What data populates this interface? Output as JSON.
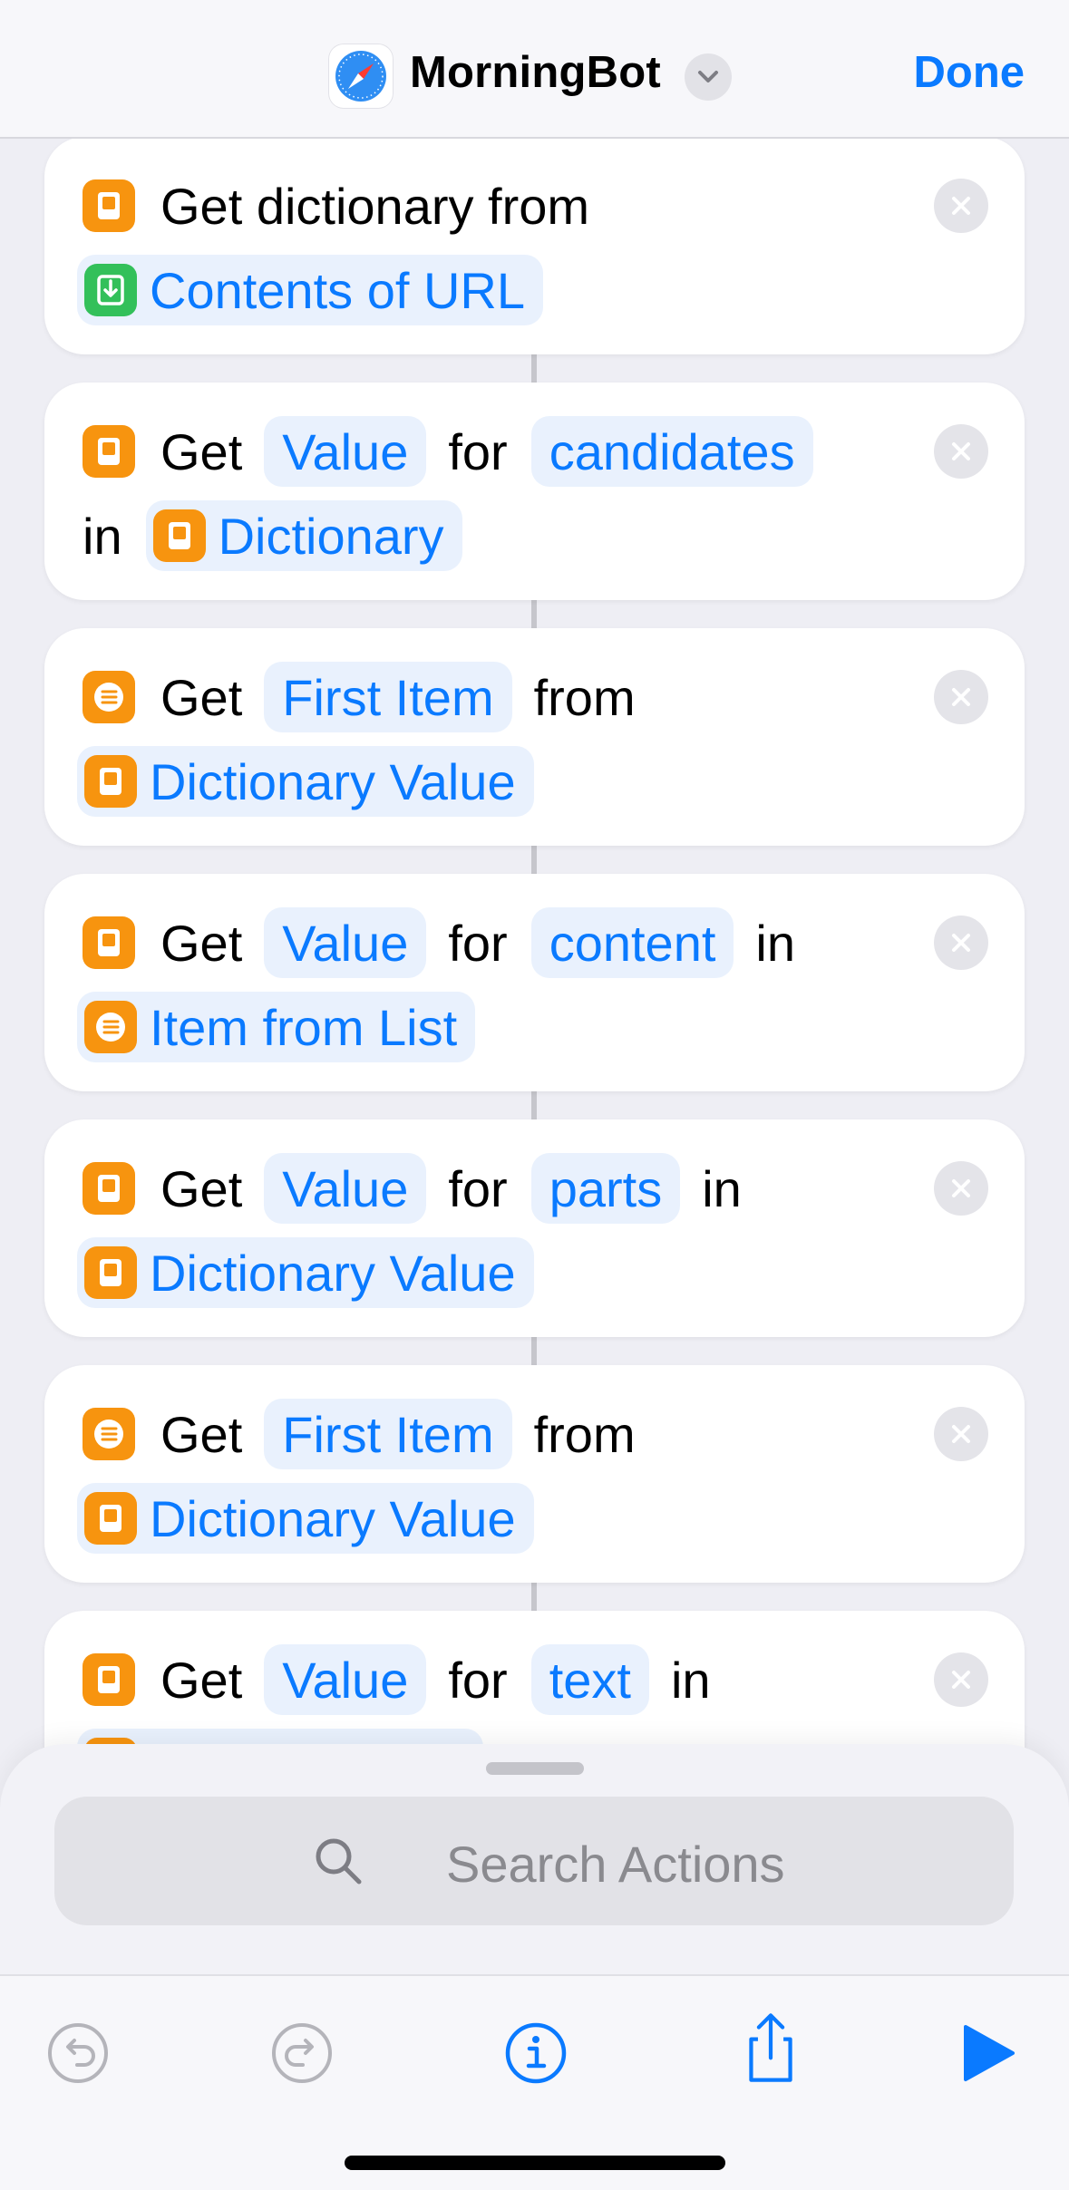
{
  "header": {
    "app_icon": "safari-compass-icon",
    "title": "MorningBot",
    "chevron": "chevron-down-icon",
    "done_label": "Done"
  },
  "actions": [
    {
      "icon": "dictionary-icon",
      "line1": {
        "lead": "Get dictionary from"
      },
      "line2": {
        "var_icon": "download-icon",
        "var_label": "Contents of URL"
      }
    },
    {
      "icon": "dictionary-icon",
      "line1": {
        "lead": "Get",
        "param1": "Value",
        "mid": "for",
        "param2": "candidates"
      },
      "line2": {
        "lead": "in",
        "var_icon": "dictionary-icon",
        "var_label": "Dictionary"
      }
    },
    {
      "icon": "list-icon",
      "line1": {
        "lead": "Get",
        "param1": "First Item",
        "mid": "from"
      },
      "line2": {
        "var_icon": "dictionary-icon",
        "var_label": "Dictionary Value"
      }
    },
    {
      "icon": "dictionary-icon",
      "line1": {
        "lead": "Get",
        "param1": "Value",
        "mid": "for",
        "param2": "content",
        "tail": "in"
      },
      "line2": {
        "var_icon": "list-icon",
        "var_label": "Item from List"
      }
    },
    {
      "icon": "dictionary-icon",
      "line1": {
        "lead": "Get",
        "param1": "Value",
        "mid": "for",
        "param2": "parts",
        "tail": "in"
      },
      "line2": {
        "var_icon": "dictionary-icon",
        "var_label": "Dictionary Value"
      }
    },
    {
      "icon": "list-icon",
      "line1": {
        "lead": "Get",
        "param1": "First Item",
        "mid": "from"
      },
      "line2": {
        "var_icon": "dictionary-icon",
        "var_label": "Dictionary Value"
      }
    },
    {
      "icon": "dictionary-icon",
      "line1": {
        "lead": "Get",
        "param1": "Value",
        "mid": "for",
        "param2": "text",
        "tail": "in"
      }
    }
  ],
  "search": {
    "icon": "search-icon",
    "placeholder": "Search Actions"
  },
  "toolbar": {
    "undo": "undo-icon",
    "redo": "redo-icon",
    "info": "info-icon",
    "share": "share-icon",
    "run": "play-icon"
  },
  "colors": {
    "accent": "#0A7AFF",
    "token_bg": "#E9F1FD",
    "dictionary_orange": "#F7940F",
    "download_green": "#33C05A"
  }
}
